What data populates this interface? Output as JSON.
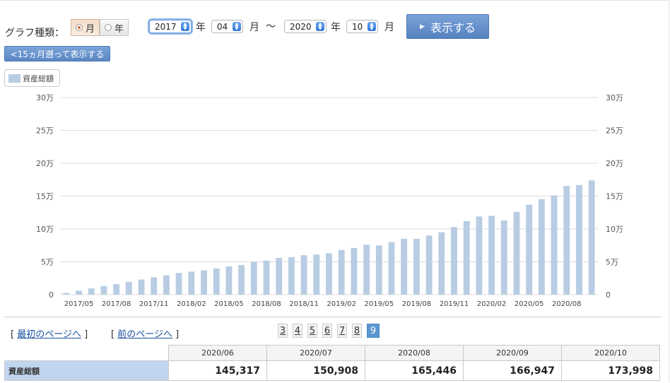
{
  "controls": {
    "graph_type_label": "グラフ種類：",
    "radio_month": "月",
    "radio_year": "年",
    "start_year": "2017",
    "start_year_unit": "年",
    "start_month": "04",
    "start_month_unit": "月",
    "range_sep": "〜",
    "end_year": "2020",
    "end_year_unit": "年",
    "end_month": "10",
    "end_month_unit": "月",
    "show_button": "表示する",
    "back_button": "<15ヵ月遡って表示する"
  },
  "legend": {
    "label": "資産総額",
    "color": "#b8cde3"
  },
  "chart_data": {
    "type": "bar",
    "categories": [
      "2017/04",
      "2017/05",
      "2017/06",
      "2017/07",
      "2017/08",
      "2017/09",
      "2017/10",
      "2017/11",
      "2017/12",
      "2018/01",
      "2018/02",
      "2018/03",
      "2018/04",
      "2018/05",
      "2018/06",
      "2018/07",
      "2018/08",
      "2018/09",
      "2018/10",
      "2018/11",
      "2018/12",
      "2019/01",
      "2019/02",
      "2019/03",
      "2019/04",
      "2019/05",
      "2019/06",
      "2019/07",
      "2019/08",
      "2019/09",
      "2019/10",
      "2019/11",
      "2019/12",
      "2020/01",
      "2020/02",
      "2020/03",
      "2020/04",
      "2020/05",
      "2020/06",
      "2020/07",
      "2020/08",
      "2020/09",
      "2020/10"
    ],
    "x_tick_labels": [
      "2017/05",
      "2017/08",
      "2017/11",
      "2018/02",
      "2018/05",
      "2018/08",
      "2018/11",
      "2019/02",
      "2019/05",
      "2019/08",
      "2019/11",
      "2020/02",
      "2020/05",
      "2020/08"
    ],
    "series": [
      {
        "name": "資産総額",
        "color": "#b8cde3",
        "values": [
          2500,
          6000,
          9500,
          13000,
          16000,
          19500,
          23000,
          26500,
          29500,
          33000,
          35000,
          37000,
          40000,
          43000,
          45000,
          50000,
          52000,
          56000,
          57000,
          60000,
          61000,
          63000,
          68000,
          71000,
          76000,
          75000,
          80000,
          85000,
          85000,
          90000,
          95000,
          103000,
          112000,
          119000,
          120000,
          113000,
          126000,
          137000,
          145317,
          150908,
          165446,
          166947,
          173998
        ]
      }
    ],
    "ylim": [
      0,
      300000
    ],
    "y_ticks": [
      0,
      50000,
      100000,
      150000,
      200000,
      250000,
      300000
    ],
    "y_tick_labels": [
      "0",
      "5万",
      "10万",
      "15万",
      "20万",
      "25万",
      "30万"
    ],
    "gridlines": true,
    "dual_y_axis": true
  },
  "pagination": {
    "first_page": "最初のページへ",
    "prev_page": "前のページへ",
    "pages": [
      "3",
      "4",
      "5",
      "6",
      "7",
      "8",
      "9"
    ],
    "current": "9"
  },
  "table": {
    "columns": [
      "2020/06",
      "2020/07",
      "2020/08",
      "2020/09",
      "2020/10"
    ],
    "rows": [
      {
        "label": "資産総額",
        "values": [
          "145,317",
          "150,908",
          "165,446",
          "166,947",
          "173,998"
        ]
      }
    ]
  }
}
